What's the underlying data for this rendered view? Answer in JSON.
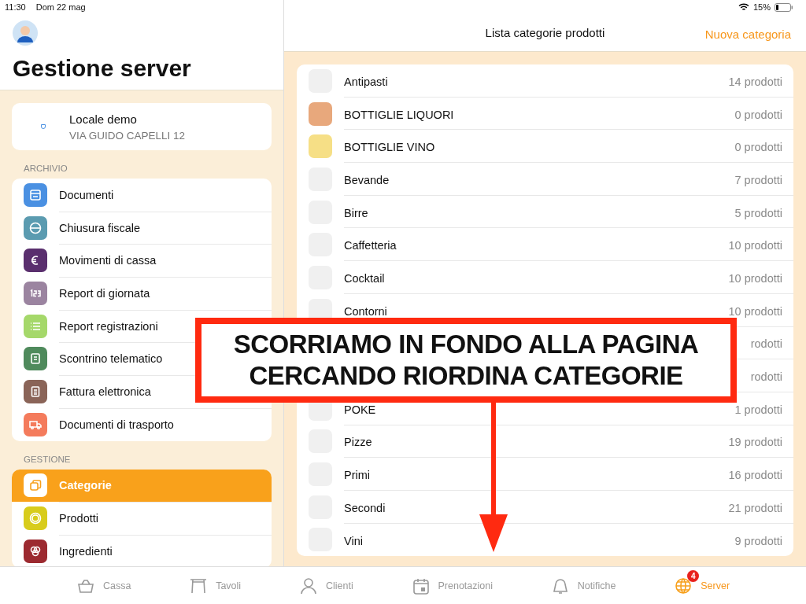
{
  "status_bar": {
    "time": "11:30",
    "date": "Dom 22 mag",
    "battery": "15%"
  },
  "sidebar": {
    "title": "Gestione server",
    "venue": {
      "name": "Locale demo",
      "address": "VIA GUIDO CAPELLI 12"
    },
    "sections": [
      {
        "heading": "ARCHIVIO",
        "items": [
          {
            "label": "Documenti",
            "color": "#4a90e2",
            "selected": false
          },
          {
            "label": "Chiusura fiscale",
            "color": "#5b9bb0",
            "selected": false
          },
          {
            "label": "Movimenti di cassa",
            "color": "#5a2f6e",
            "selected": false
          },
          {
            "label": "Report di giornata",
            "color": "#9b84a0",
            "selected": false
          },
          {
            "label": "Report registrazioni",
            "color": "#a5d86a",
            "selected": false
          },
          {
            "label": "Scontrino telematico",
            "color": "#4f8a5c",
            "selected": false
          },
          {
            "label": "Fattura elettronica",
            "color": "#8a6458",
            "selected": false
          },
          {
            "label": "Documenti di trasporto",
            "color": "#f47b5c",
            "selected": false
          }
        ]
      },
      {
        "heading": "GESTIONE",
        "items": [
          {
            "label": "Categorie",
            "color": "#ffffff",
            "selected": true
          },
          {
            "label": "Prodotti",
            "color": "#d8cc1c",
            "selected": false
          },
          {
            "label": "Ingredienti",
            "color": "#9c2a30",
            "selected": false
          }
        ]
      }
    ]
  },
  "header": {
    "title": "Lista categorie prodotti",
    "action": "Nuova categoria"
  },
  "categories": [
    {
      "name": "Antipasti",
      "count": "14 prodotti",
      "color": "#f0f0f0"
    },
    {
      "name": "BOTTIGLIE LIQUORI",
      "count": "0 prodotti",
      "color": "#e8a87c"
    },
    {
      "name": "BOTTIGLIE VINO",
      "count": "0 prodotti",
      "color": "#f6df86"
    },
    {
      "name": "Bevande",
      "count": "7 prodotti",
      "color": "#f0f0f0"
    },
    {
      "name": "Birre",
      "count": "5 prodotti",
      "color": "#f0f0f0"
    },
    {
      "name": "Caffetteria",
      "count": "10 prodotti",
      "color": "#f0f0f0"
    },
    {
      "name": "Cocktail",
      "count": "10 prodotti",
      "color": "#f0f0f0"
    },
    {
      "name": "Contorni",
      "count": "10 prodotti",
      "color": "#f0f0f0"
    },
    {
      "count": "rodotti"
    },
    {
      "count": "rodotti"
    },
    {
      "name": "POKE",
      "count": "1 prodotti",
      "color": "#f0f0f0"
    },
    {
      "name": "Pizze",
      "count": "19 prodotti",
      "color": "#f0f0f0"
    },
    {
      "name": "Primi",
      "count": "16 prodotti",
      "color": "#f0f0f0"
    },
    {
      "name": "Secondi",
      "count": "21 prodotti",
      "color": "#f0f0f0"
    },
    {
      "name": "Vini",
      "count": "9 prodotti",
      "color": "#f0f0f0"
    }
  ],
  "tab_bar": [
    {
      "label": "Cassa",
      "selected": false
    },
    {
      "label": "Tavoli",
      "selected": false
    },
    {
      "label": "Clienti",
      "selected": false
    },
    {
      "label": "Prenotazioni",
      "selected": false
    },
    {
      "label": "Notifiche",
      "selected": false
    },
    {
      "label": "Server",
      "selected": true,
      "badge": "4"
    }
  ],
  "callout": {
    "lines": [
      "SCORRIAMO IN FONDO ALLA PAGINA",
      "CERCANDO RIORDINA CATEGORIE"
    ]
  }
}
